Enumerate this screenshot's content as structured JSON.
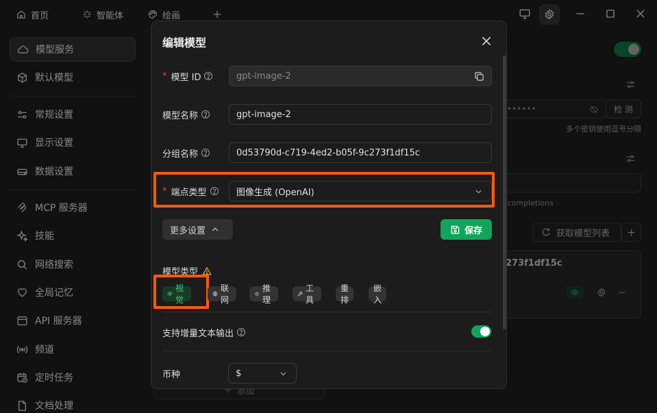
{
  "topbar": {
    "tabs": [
      {
        "label": "首页",
        "icon": "home-icon"
      },
      {
        "label": "智能体",
        "icon": "sparkle-icon"
      },
      {
        "label": "绘画",
        "icon": "palette-icon"
      }
    ],
    "add_tab_icon": "plus-icon"
  },
  "sidebar": {
    "items": [
      {
        "label": "模型服务",
        "icon": "cloud-icon",
        "active": true
      },
      {
        "label": "默认模型",
        "icon": "cube-icon"
      },
      {
        "label": "常规设置",
        "icon": "sliders-icon"
      },
      {
        "label": "显示设置",
        "icon": "monitor-icon"
      },
      {
        "label": "数据设置",
        "icon": "drive-icon"
      },
      {
        "label": "MCP 服务器",
        "icon": "mcp-icon"
      },
      {
        "label": "技能",
        "icon": "sparkles-icon"
      },
      {
        "label": "网络搜索",
        "icon": "search-icon"
      },
      {
        "label": "全局记忆",
        "icon": "memory-icon"
      },
      {
        "label": "API 服务器",
        "icon": "api-icon"
      },
      {
        "label": "频道",
        "icon": "radio-icon"
      },
      {
        "label": "定时任务",
        "icon": "calendar-clock-icon"
      },
      {
        "label": "文档处理",
        "icon": "document-icon"
      }
    ]
  },
  "background": {
    "check_button": "检 测",
    "key_hint": "多个密钥使用逗号分隔",
    "api_hint": "/completions",
    "fetch_models_button": "获取模型列表",
    "group_fragment": "273f1df15c",
    "add_button": "添加",
    "masked_key": "••••••"
  },
  "modal": {
    "title": "编辑模型",
    "model_id_label": "模型 ID",
    "model_id_value": "gpt-image-2",
    "model_name_label": "模型名称",
    "model_name_value": "gpt-image-2",
    "group_label": "分组名称",
    "group_value": "0d53790d-c719-4ed2-b05f-9c273f1df15c",
    "endpoint_label": "端点类型",
    "endpoint_value": "图像生成 (OpenAI)",
    "more_settings": "更多设置",
    "save": "保存",
    "model_type_label": "模型类型",
    "tags": [
      {
        "label": "视觉",
        "icon": "eye-icon",
        "selected": true
      },
      {
        "label": "联网",
        "icon": "globe-icon",
        "selected": false
      },
      {
        "label": "推理",
        "icon": "bulb-icon",
        "selected": false
      },
      {
        "label": "工具",
        "icon": "wrench-icon",
        "selected": false
      },
      {
        "label": "重排",
        "icon": "",
        "selected": false
      },
      {
        "label": "嵌入",
        "icon": "",
        "selected": false
      }
    ],
    "streaming_label": "支持增量文本输出",
    "streaming_enabled": true,
    "currency_label": "币种",
    "currency_value": "$"
  },
  "colors": {
    "accent_green": "#11a55b",
    "highlight_orange": "#ff5a0a"
  }
}
